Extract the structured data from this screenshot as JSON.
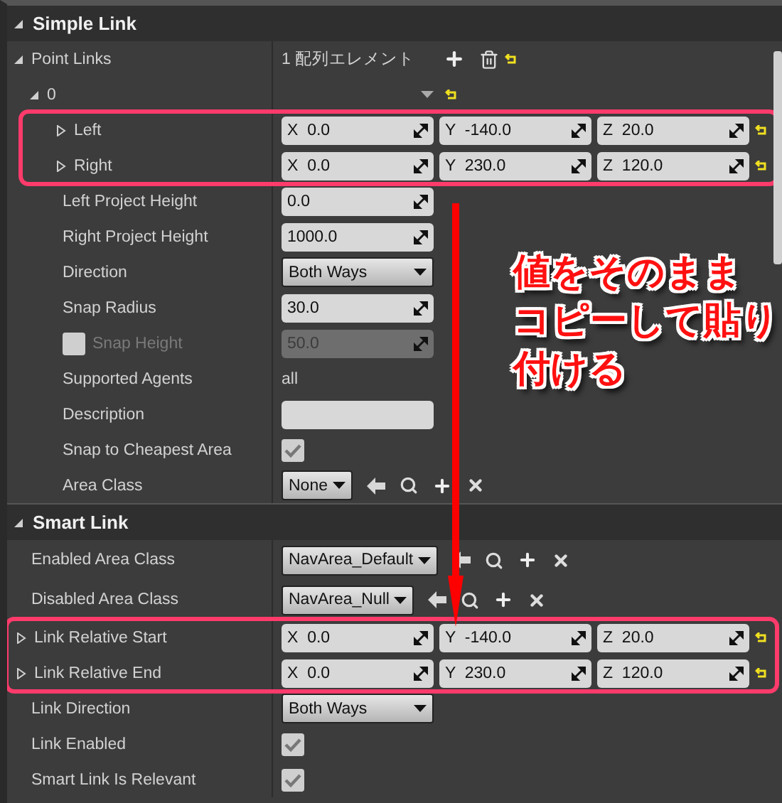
{
  "sections": [
    {
      "title": "Simple Link",
      "expanded": true,
      "rows": [
        {
          "kind": "array",
          "label": "Point Links",
          "expanded": true,
          "value": "1 配列エレメント",
          "children": [
            {
              "kind": "group",
              "label": "0",
              "expanded": true,
              "children": [
                {
                  "kind": "vector",
                  "label": "Left",
                  "expanded": false,
                  "highlighted": true,
                  "components": [
                    {
                      "axis": "X",
                      "value": "0.0"
                    },
                    {
                      "axis": "Y",
                      "value": "-140.0"
                    },
                    {
                      "axis": "Z",
                      "value": "20.0"
                    }
                  ]
                },
                {
                  "kind": "vector",
                  "label": "Right",
                  "expanded": false,
                  "highlighted": true,
                  "components": [
                    {
                      "axis": "X",
                      "value": "0.0"
                    },
                    {
                      "axis": "Y",
                      "value": "230.0"
                    },
                    {
                      "axis": "Z",
                      "value": "120.0"
                    }
                  ]
                },
                {
                  "kind": "number",
                  "label": "Left Project Height",
                  "value": "0.0"
                },
                {
                  "kind": "number",
                  "label": "Right Project Height",
                  "value": "1000.0"
                },
                {
                  "kind": "dropdown",
                  "label": "Direction",
                  "value": "Both Ways"
                },
                {
                  "kind": "number",
                  "label": "Snap Radius",
                  "value": "30.0"
                },
                {
                  "kind": "toggled_number",
                  "label": "Snap Height",
                  "checked": false,
                  "disabled": true,
                  "value": "50.0"
                },
                {
                  "kind": "text",
                  "label": "Supported Agents",
                  "value": "all"
                },
                {
                  "kind": "textfield",
                  "label": "Description"
                },
                {
                  "kind": "checkbox",
                  "label": "Snap to Cheapest Area",
                  "checked": true
                },
                {
                  "kind": "class",
                  "label": "Area Class",
                  "value": "None"
                }
              ]
            }
          ]
        }
      ]
    },
    {
      "title": "Smart Link",
      "expanded": true,
      "rows": [
        {
          "kind": "class",
          "label": "Enabled Area Class",
          "value": "NavArea_Default"
        },
        {
          "kind": "class",
          "label": "Disabled Area Class",
          "value": "NavArea_Null"
        },
        {
          "kind": "vector",
          "label": "Link Relative Start",
          "expanded": false,
          "highlighted": true,
          "components": [
            {
              "axis": "X",
              "value": "0.0"
            },
            {
              "axis": "Y",
              "value": "-140.0"
            },
            {
              "axis": "Z",
              "value": "20.0"
            }
          ]
        },
        {
          "kind": "vector",
          "label": "Link Relative End",
          "expanded": false,
          "highlighted": true,
          "components": [
            {
              "axis": "X",
              "value": "0.0"
            },
            {
              "axis": "Y",
              "value": "230.0"
            },
            {
              "axis": "Z",
              "value": "120.0"
            }
          ]
        },
        {
          "kind": "dropdown",
          "label": "Link Direction",
          "value": "Both Ways"
        },
        {
          "kind": "checkbox",
          "label": "Link Enabled",
          "checked": true
        },
        {
          "kind": "checkbox",
          "label": "Smart Link Is Relevant",
          "checked": true
        }
      ]
    }
  ],
  "annotation": {
    "lines": [
      "値をそのまま",
      "コピーして貼り",
      "付ける"
    ]
  }
}
